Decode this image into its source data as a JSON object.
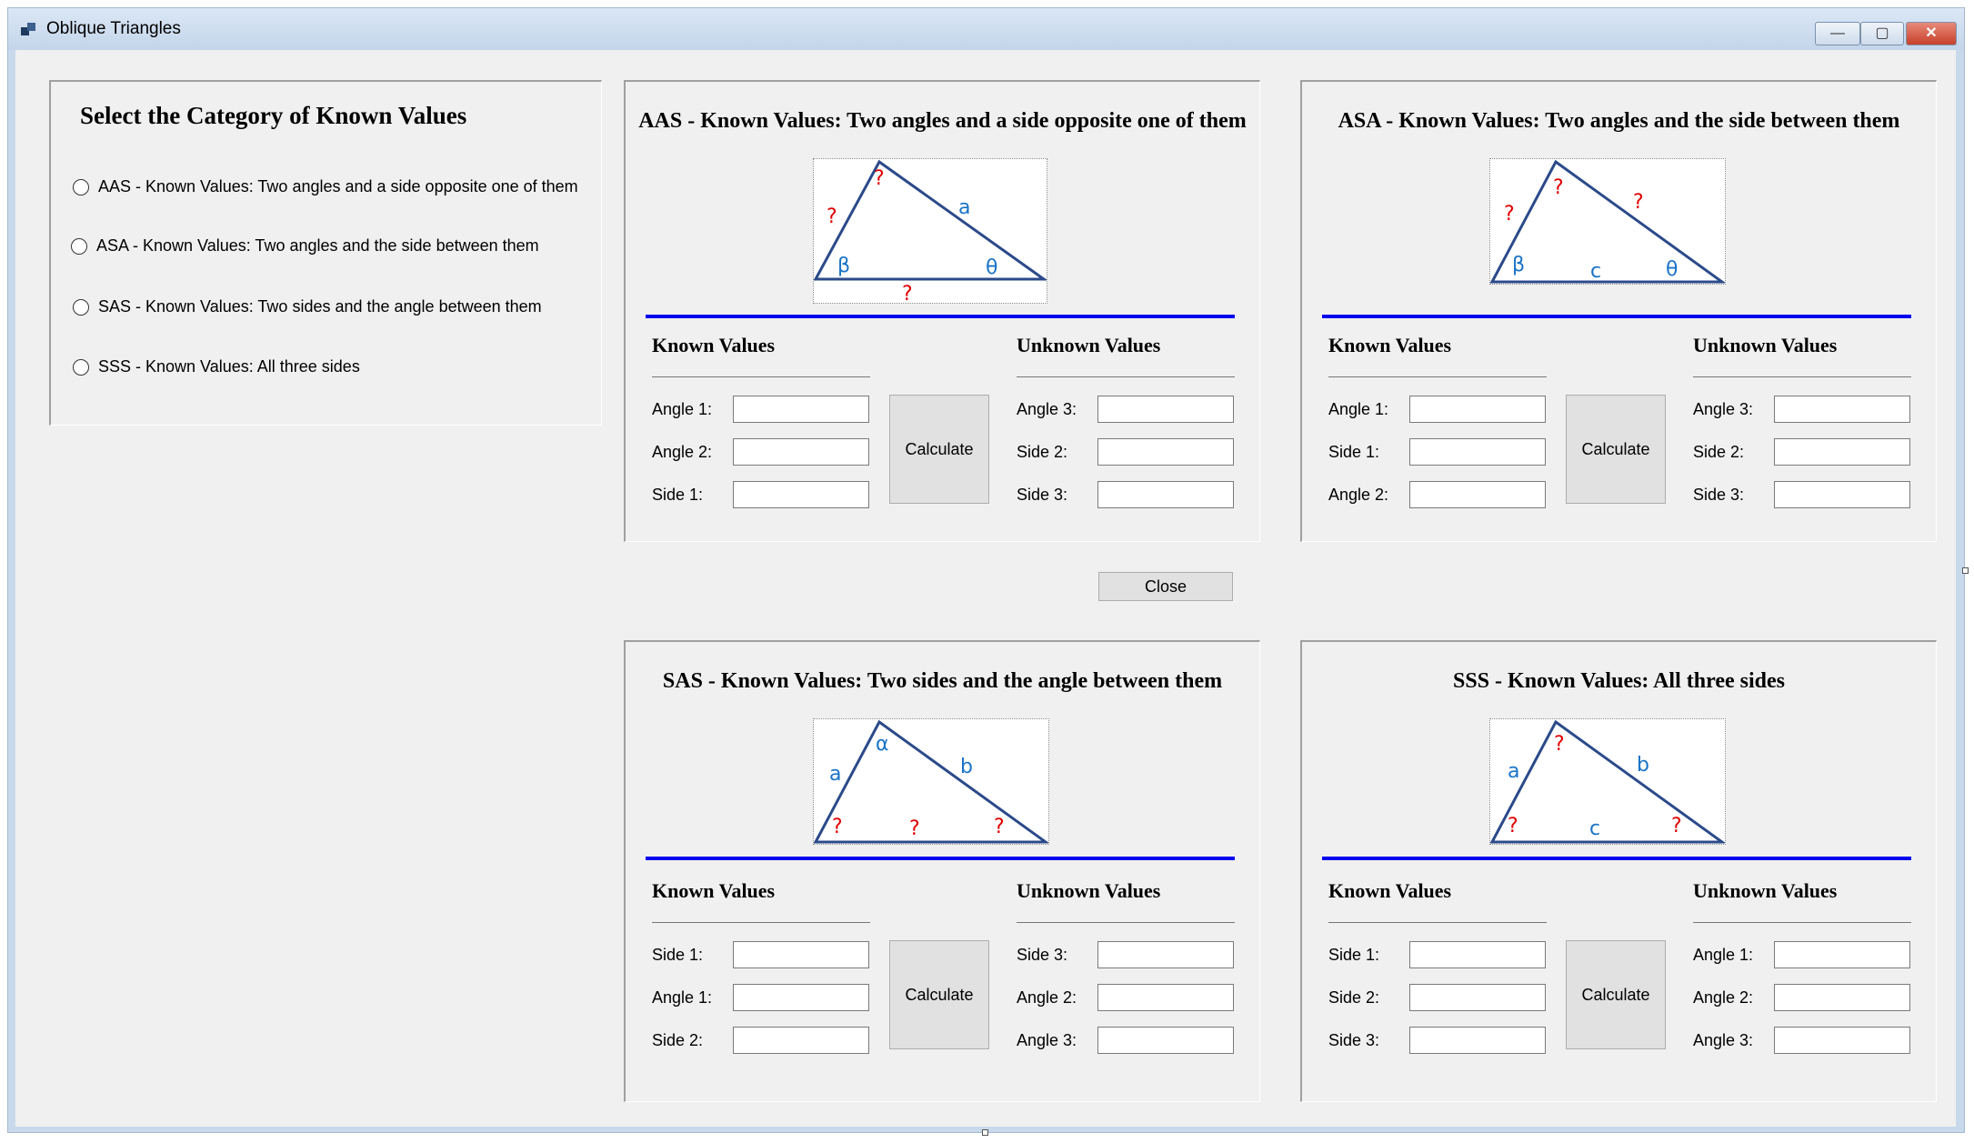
{
  "window": {
    "title": "Oblique Triangles"
  },
  "selector": {
    "title": "Select the Category of Known Values",
    "options": [
      "AAS - Known Values: Two angles and a side opposite one of them",
      "ASA - Known Values: Two angles and the side between them",
      "SAS - Known Values: Two sides and the angle between them",
      "SSS - Known Values: All three sides"
    ]
  },
  "common": {
    "known_head": "Known Values",
    "unknown_head": "Unknown Values",
    "calculate": "Calculate",
    "close": "Close"
  },
  "colors": {
    "accent_rule": "#0000ee",
    "triangle": "#2b4a8a",
    "known_label": "#1a73c7",
    "unknown_label": "#e00000"
  },
  "aas": {
    "title": "AAS - Known Values: Two angles and a side opposite one of them",
    "known": [
      "Angle 1:",
      "Angle 2:",
      "Side 1:"
    ],
    "unknown": [
      "Angle 3:",
      "Side 2:",
      "Side 3:"
    ],
    "fig": {
      "top": "?",
      "left": "?",
      "right": "a",
      "bl": "β",
      "br": "θ",
      "bottom": "?"
    }
  },
  "asa": {
    "title": "ASA - Known Values: Two angles and the side between them",
    "known": [
      "Angle 1:",
      "Side 1:",
      "Angle 2:"
    ],
    "unknown": [
      "Angle 3:",
      "Side 2:",
      "Side 3:"
    ],
    "fig": {
      "top": "?",
      "left": "?",
      "right": "?",
      "bl": "β",
      "br": "θ",
      "bottom": "c"
    }
  },
  "sas": {
    "title": "SAS - Known Values: Two sides and the angle between them",
    "known": [
      "Side 1:",
      "Angle 1:",
      "Side 2:"
    ],
    "unknown": [
      "Side 3:",
      "Angle 2:",
      "Angle 3:"
    ],
    "fig": {
      "top": "α",
      "left": "a",
      "right": "b",
      "bl": "?",
      "br": "?",
      "bottom": "?"
    }
  },
  "sss": {
    "title": "SSS - Known Values: All three sides",
    "known": [
      "Side 1:",
      "Side 2:",
      "Side 3:"
    ],
    "unknown": [
      "Angle 1:",
      "Angle 2:",
      "Angle 3:"
    ],
    "fig": {
      "top": "?",
      "left": "a",
      "right": "b",
      "bl": "?",
      "br": "?",
      "bottom": "c"
    }
  }
}
